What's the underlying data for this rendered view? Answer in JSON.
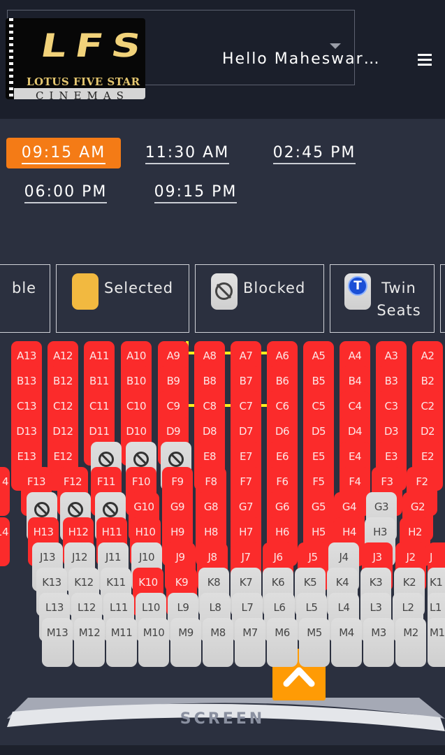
{
  "header": {
    "logo": {
      "main": "LFS",
      "subtitle": "LOTUS FIVE STAR",
      "bottom": "CINEMAS"
    },
    "greeting": "Hello Maheswar…"
  },
  "showtimes": [
    {
      "label": "09:15 AM",
      "active": true
    },
    {
      "label": "11:30 AM",
      "active": false
    },
    {
      "label": "02:45 PM",
      "active": false
    },
    {
      "label": "06:00 PM",
      "active": false
    },
    {
      "label": "09:15 PM",
      "active": false
    }
  ],
  "legend": [
    {
      "label": "ble",
      "kind": "partial"
    },
    {
      "label": "Selected",
      "kind": "selected",
      "color": "#f2b940"
    },
    {
      "label": "Blocked",
      "kind": "blocked"
    },
    {
      "label": "Twin Seats",
      "kind": "twin"
    }
  ],
  "colors": {
    "available": "#fb2b2b",
    "taken": "#d6d6d6",
    "accent": "#f47b16",
    "highlight": "#ffee1e",
    "scrollTop": "#ff9b05"
  },
  "rows": [
    {
      "row": "A",
      "seats": [
        "A13:r",
        "A12:r",
        "A11:r",
        "A10:r",
        "A9:r",
        "A8:r",
        "A7:r",
        "A6:r",
        "A5:r",
        "A4:r",
        "A3:r",
        "A2:r"
      ]
    },
    {
      "row": "B",
      "seats": [
        "B13:r",
        "B12:r",
        "B11:r",
        "B10:r",
        "B9:r",
        "B8:r",
        "B7:r",
        "B6:r",
        "B5:r",
        "B4:r",
        "B3:r",
        "B2:r"
      ]
    },
    {
      "row": "C",
      "seats": [
        "C13:r",
        "C12:r",
        "C11:r",
        "C10:r",
        "C9:r",
        "C8:r",
        "C7:r",
        "C6:r",
        "C5:r",
        "C4:r",
        "C3:r",
        "C2:r"
      ]
    },
    {
      "row": "D",
      "seats": [
        "D13:r",
        "D12:r",
        "D11:r",
        "D10:r",
        "D9:r",
        "D8:r",
        "D7:r",
        "D6:r",
        "D5:r",
        "D4:r",
        "D3:r",
        "D2:r"
      ]
    },
    {
      "row": "E",
      "seats": [
        "E13:r",
        "E12:r",
        "X:b",
        "X:b",
        "X:b",
        "E8:r",
        "E7:r",
        "E6:r",
        "E5:r",
        "E4:r",
        "E3:r",
        "E2:r"
      ]
    },
    {
      "row": "F",
      "seats": [
        "F13:r",
        "F12:r",
        "F11:r",
        "F10:r",
        "F9:r",
        "F8:r",
        "F7:r",
        "F6:r",
        "F5:r",
        "F4:r",
        "F3:r",
        "F2:r"
      ]
    },
    {
      "row": "G",
      "seats": [
        "X:b",
        "X:b",
        "X:b",
        "G10:r",
        "G9:r",
        "G8:r",
        "G7:r",
        "G6:r",
        "G5:r",
        "G4:r",
        "G3:g",
        "G2:r"
      ]
    },
    {
      "row": "H",
      "seats": [
        "H13:r",
        "H12:r",
        "H11:r",
        "H10:r",
        "H9:r",
        "H8:r",
        "H7:r",
        "H6:r",
        "H5:r",
        "H4:r",
        "H3:g",
        "H2:r"
      ]
    },
    {
      "row": "J",
      "seats": [
        "J13:g",
        "J12:g",
        "J11:g",
        "J10:g",
        "J9:r",
        "J8:r",
        "J7:r",
        "J6:r",
        "J5:r",
        "J4:g",
        "J3:r",
        "J2:r"
      ]
    },
    {
      "row": "K",
      "seats": [
        "K13:g",
        "K12:g",
        "K11:g",
        "K10:r",
        "K9:r",
        "K8:g",
        "K7:g",
        "K6:g",
        "K5:g",
        "K4:g",
        "K3:g",
        "K2:g"
      ]
    },
    {
      "row": "L",
      "seats": [
        "L13:g",
        "L12:g",
        "L11:g",
        "L10:g",
        "L9:g",
        "L8:g",
        "L7:g",
        "L6:g",
        "L5:g",
        "L4:g",
        "L3:g",
        "L2:g"
      ]
    },
    {
      "row": "M",
      "seats": [
        "M13:g",
        "M12:g",
        "M11:g",
        "M10:g",
        "M9:g",
        "M8:g",
        "M7:g",
        "M6:g",
        "M5:g",
        "M4:g",
        "M3:g",
        "M2:g"
      ]
    }
  ],
  "edgeLabels": {
    "F": "4",
    "H": "14",
    "K": "K1",
    "L": "L1",
    "M": "M1",
    "J": "J"
  },
  "screen": {
    "label": "SCREEN"
  }
}
